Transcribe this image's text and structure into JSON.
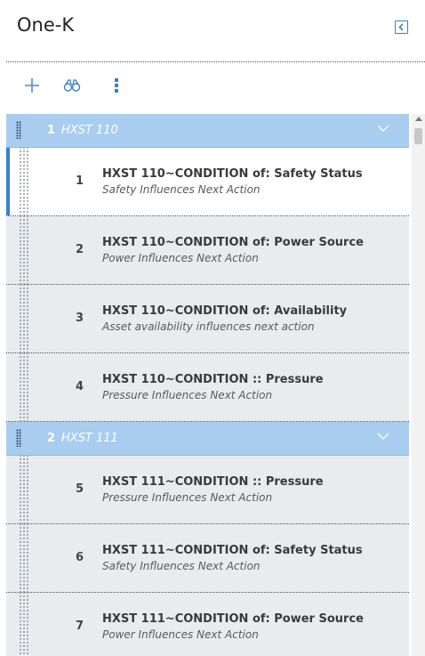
{
  "header": {
    "title": "One-K"
  },
  "colors": {
    "accent": "#3a7ecf",
    "group_header": "#a9cdef",
    "item_bg": "#e8ecef"
  },
  "toolbar": {
    "icons": [
      "plus-icon",
      "binoculars-icon",
      "more-vertical-icon"
    ]
  },
  "groups": [
    {
      "num": "1",
      "name": "HXST 110",
      "items": [
        {
          "num": "1",
          "title": "HXST 110~CONDITION of: Safety Status",
          "subtitle": "Safety Influences Next Action",
          "selected": true
        },
        {
          "num": "2",
          "title": "HXST 110~CONDITION of: Power Source",
          "subtitle": "Power Influences Next Action"
        },
        {
          "num": "3",
          "title": "HXST 110~CONDITION of: Availability",
          "subtitle": "Asset availability influences next action"
        },
        {
          "num": "4",
          "title": "HXST 110~CONDITION :: Pressure",
          "subtitle": "Pressure Influences Next Action"
        }
      ]
    },
    {
      "num": "2",
      "name": "HXST 111",
      "items": [
        {
          "num": "5",
          "title": "HXST 111~CONDITION :: Pressure",
          "subtitle": "Pressure Influences Next Action"
        },
        {
          "num": "6",
          "title": "HXST 111~CONDITION of: Safety Status",
          "subtitle": "Safety Influences Next Action"
        },
        {
          "num": "7",
          "title": "HXST 111~CONDITION of: Power Source",
          "subtitle": "Power Influences Next Action"
        }
      ]
    }
  ]
}
